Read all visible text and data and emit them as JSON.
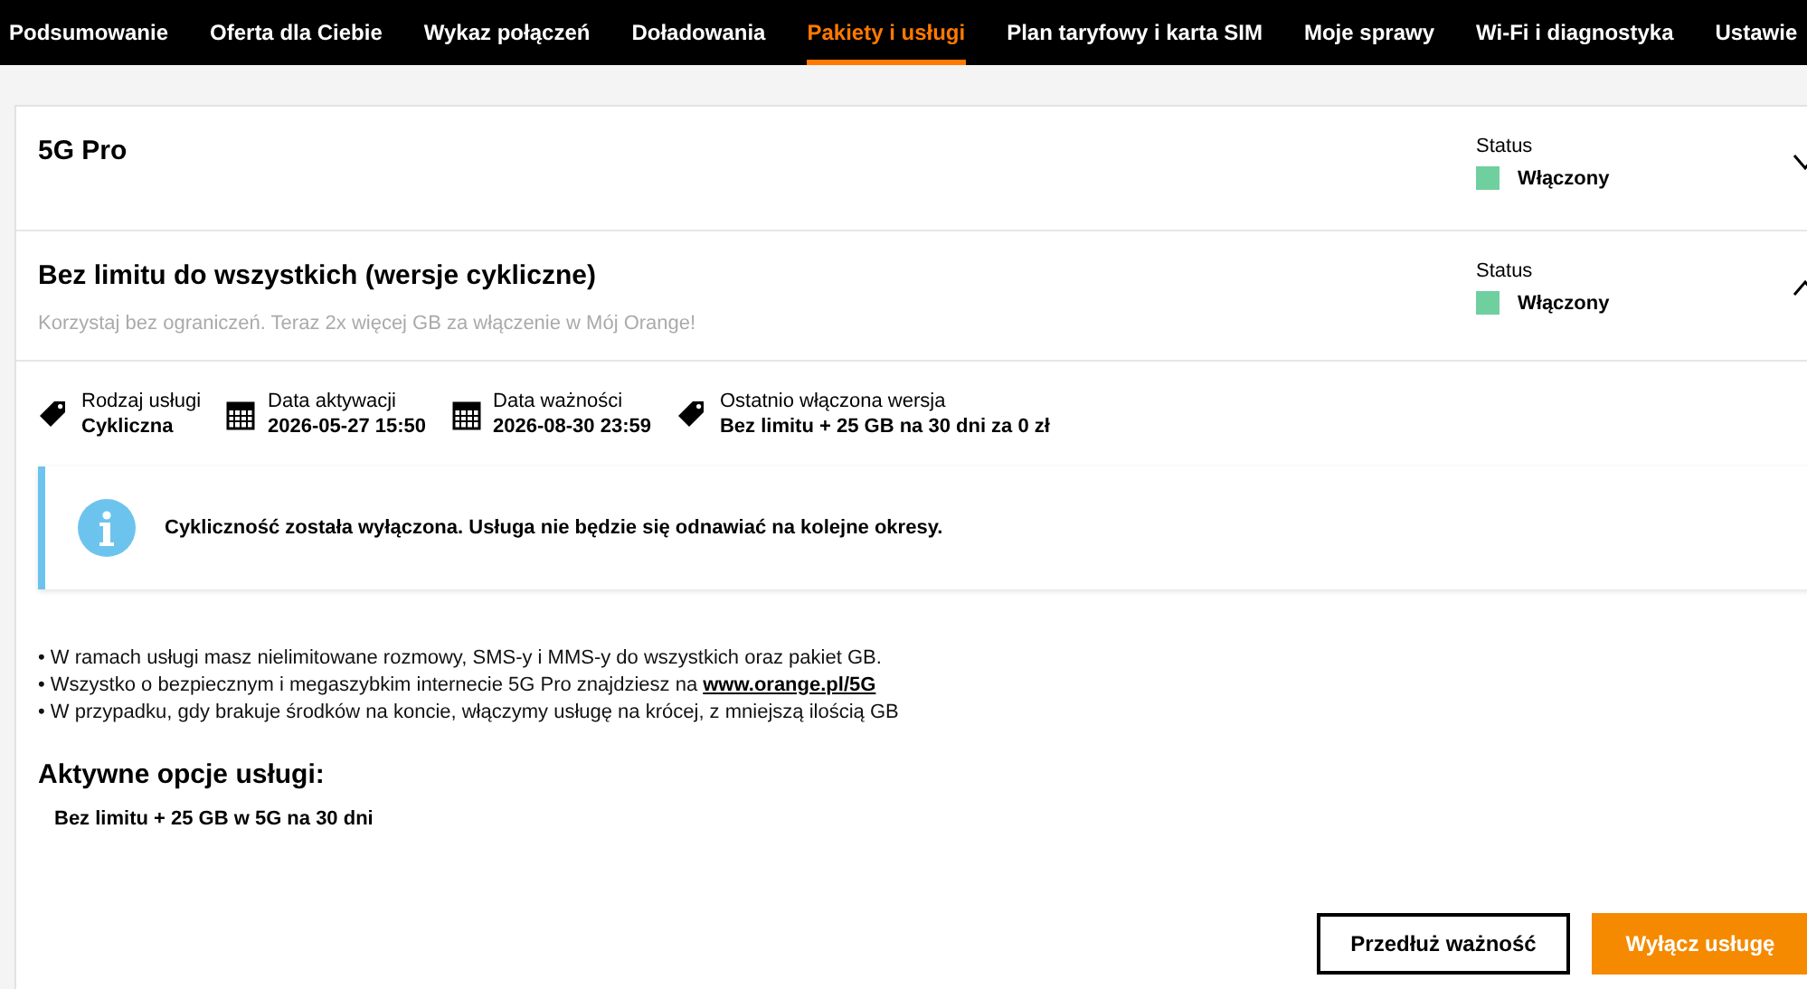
{
  "nav": [
    {
      "label": "Podsumowanie",
      "selected": false
    },
    {
      "label": "Oferta dla Ciebie",
      "selected": false
    },
    {
      "label": "Wykaz połączeń",
      "selected": false
    },
    {
      "label": "Doładowania",
      "selected": false
    },
    {
      "label": "Pakiety i usługi",
      "selected": true
    },
    {
      "label": "Plan taryfowy i karta SIM",
      "selected": false
    },
    {
      "label": "Moje sprawy",
      "selected": false
    },
    {
      "label": "Wi-Fi i diagnostyka",
      "selected": false
    },
    {
      "label": "Ustawie",
      "selected": false
    }
  ],
  "services": [
    {
      "name": "5G Pro",
      "expanded": false,
      "status_label": "Status",
      "status": "Włączony",
      "color": "#6fcf9f"
    },
    {
      "name": "Bez limitu do wszystkich (wersje cykliczne)",
      "subtitle": "Korzystaj bez ograniczeń. Teraz 2x więcej GB za włączenie w Mój Orange!",
      "expanded": true,
      "status_label": "Status",
      "status": "Włączony",
      "color": "#6fcf9f",
      "details": [
        {
          "kind": "tag",
          "label": "Rodzaj usługi",
          "value": "Cykliczna"
        },
        {
          "kind": "calendar",
          "label": "Data aktywacji",
          "value": "2026-05-27 15:50"
        },
        {
          "kind": "calendar",
          "label": "Data ważności",
          "value": "2026-08-30 23:59"
        },
        {
          "kind": "tag",
          "label": "Ostatnio włączona wersja",
          "value": "Bez limitu + 25 GB na 30 dni za 0 zł"
        }
      ],
      "notice": "Cykliczność została wyłączona. Usługa nie będzie się odnawiać na kolejne okresy.",
      "bullets": [
        {
          "marker": "•",
          "text": "W ramach usługi masz nielimitowane rozmowy, SMS-y i MMS-y do wszystkich oraz pakiet GB."
        },
        {
          "marker": "•",
          "text": "Wszystko o bezpiecznym i megaszybkim internecie 5G Pro znajdziesz na",
          "link": "www.orange.pl/5G"
        },
        {
          "marker": "•",
          "text": "W przypadku, gdy brakuje środków na koncie, włączymy usługę na krócej, z mniejszą ilością GB"
        }
      ],
      "options_title": "Aktywne opcje usługi:",
      "options": [
        "Bez limitu + 25 GB w 5G na 30 dni"
      ],
      "buttons": [
        {
          "label": "Przedłuż ważność",
          "kind": "secondary"
        },
        {
          "label": "Wyłącz usługę",
          "kind": "primary"
        }
      ]
    }
  ]
}
